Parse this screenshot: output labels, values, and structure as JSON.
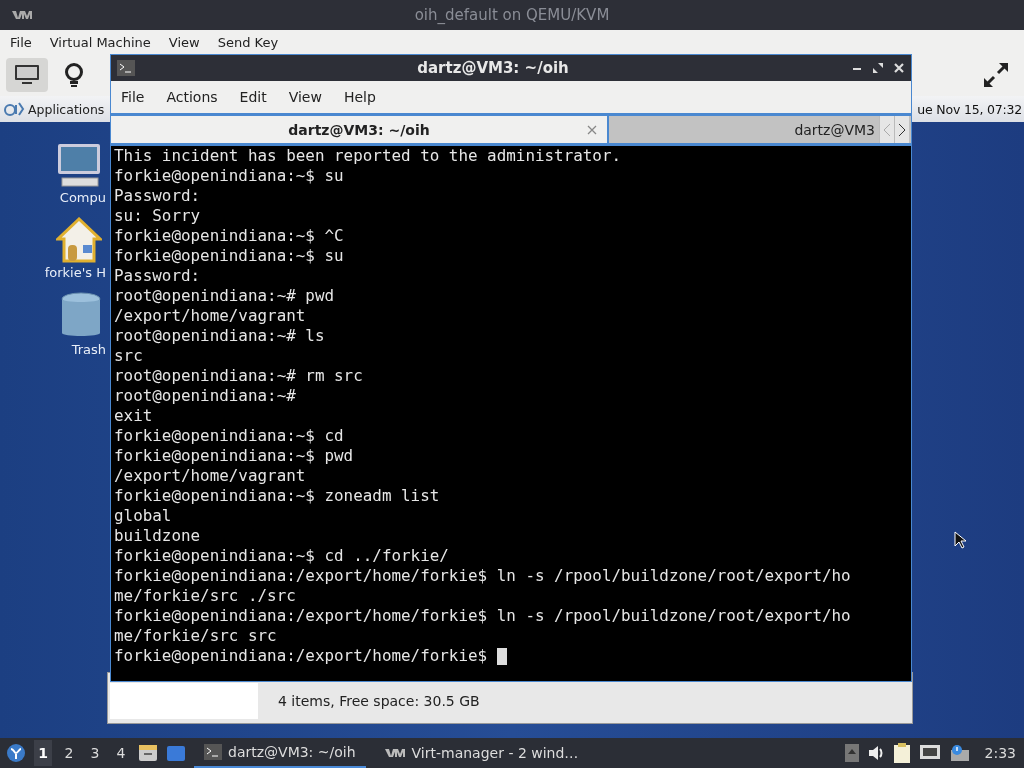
{
  "window": {
    "title": "oih_default on QEMU/KVM"
  },
  "menu": [
    "File",
    "Virtual Machine",
    "View",
    "Send Key"
  ],
  "toolbar": {
    "console_selected": true
  },
  "guest_panel": {
    "applications": "Applications",
    "clock": "ue Nov 15, 07:32"
  },
  "desktop_icons": [
    {
      "kind": "computer",
      "label": "Compu"
    },
    {
      "kind": "home",
      "label": "forkie's H"
    },
    {
      "kind": "trash",
      "label": "Trash"
    }
  ],
  "file_manager": {
    "status": "4 items, Free space: 30.5 GB"
  },
  "terminal": {
    "title": "dartz@VM3: ~/oih",
    "menu": [
      "File",
      "Actions",
      "Edit",
      "View",
      "Help"
    ],
    "tabs": [
      {
        "label": "dartz@VM3: ~/oih",
        "selected": true,
        "closable": true
      },
      {
        "label": "dartz@VM3",
        "selected": false,
        "closable": false
      }
    ],
    "lines": [
      "This incident has been reported to the administrator.",
      "forkie@openindiana:~$ su",
      "Password:",
      "su: Sorry",
      "forkie@openindiana:~$ ^C",
      "forkie@openindiana:~$ su",
      "Password:",
      "root@openindiana:~# pwd",
      "/export/home/vagrant",
      "root@openindiana:~# ls",
      "src",
      "root@openindiana:~# rm src",
      "root@openindiana:~#",
      "exit",
      "forkie@openindiana:~$ cd",
      "forkie@openindiana:~$ pwd",
      "/export/home/vagrant",
      "forkie@openindiana:~$ zoneadm list",
      "global",
      "buildzone",
      "forkie@openindiana:~$ cd ../forkie/",
      "forkie@openindiana:/export/home/forkie$ ln -s /rpool/buildzone/root/export/ho",
      "me/forkie/src ./src",
      "forkie@openindiana:/export/home/forkie$ ln -s /rpool/buildzone/root/export/ho",
      "me/forkie/src src",
      "forkie@openindiana:/export/home/forkie$"
    ]
  },
  "taskbar": {
    "workspaces": [
      {
        "label": "1",
        "selected": true
      },
      {
        "label": "2",
        "selected": false
      },
      {
        "label": "3",
        "selected": false
      },
      {
        "label": "4",
        "selected": false
      }
    ],
    "tasks": [
      {
        "kind": "terminal",
        "label": "dartz@VM3: ~/oih",
        "selected": true
      },
      {
        "kind": "virt",
        "label": "Virt-manager - 2 wind…",
        "selected": false
      }
    ],
    "clock": "2:33"
  }
}
